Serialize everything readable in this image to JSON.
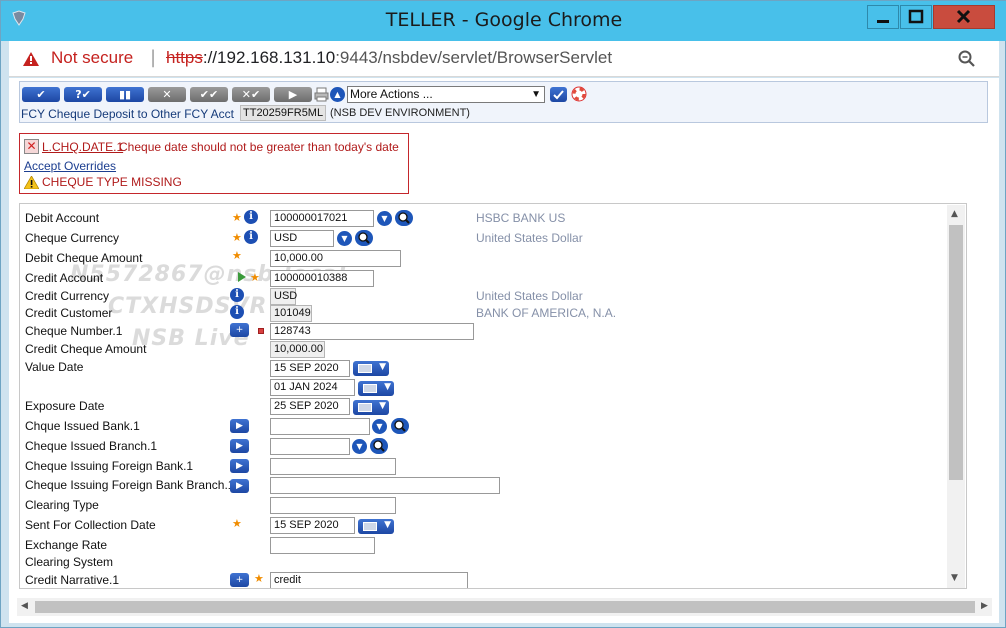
{
  "window": {
    "title": "TELLER - Google Chrome"
  },
  "address": {
    "security": "Not secure",
    "separator": "|",
    "scheme": "https",
    "host": "://192.168.131.10",
    "rest": ":9443/nsbdev/servlet/BrowserServlet"
  },
  "toolbar": {
    "more_actions": "More Actions ...",
    "transaction_label": "FCY Cheque Deposit to Other FCY Acct",
    "transaction_id": "TT20259FR5ML",
    "environment": "(NSB DEV ENVIRONMENT)"
  },
  "errors": {
    "field": "L.CHQ.DATE.1",
    "message": "Cheque date should not be greater than today's date",
    "accept_overrides": "Accept Overrides",
    "warning": "CHEQUE TYPE MISSING"
  },
  "watermark": {
    "line1": "N5572867@nsb.local",
    "line2": "CTXHSDSVR",
    "line3": "NSB Live"
  },
  "form": {
    "debit_account": {
      "label": "Debit Account",
      "value": "100000017021",
      "desc": "HSBC BANK US"
    },
    "cheque_currency": {
      "label": "Cheque Currency",
      "value": "USD",
      "desc": "United States Dollar"
    },
    "debit_cheque_amount": {
      "label": "Debit Cheque Amount",
      "value": "10,000.00"
    },
    "credit_account": {
      "label": "Credit Account",
      "value": "100000010388"
    },
    "credit_currency": {
      "label": "Credit Currency",
      "value": "USD",
      "desc": "United States Dollar"
    },
    "credit_customer": {
      "label": "Credit Customer",
      "value": "101049",
      "desc": "BANK OF AMERICA, N.A."
    },
    "cheque_number": {
      "label": "Cheque Number.1",
      "value": "128743"
    },
    "credit_cheque_amount": {
      "label": "Credit Cheque Amount",
      "value": "10,000.00"
    },
    "value_date": {
      "label": "Value Date",
      "value": "15 SEP 2020",
      "value2": "01 JAN 2024"
    },
    "exposure_date": {
      "label": "Exposure Date",
      "value": "25 SEP 2020"
    },
    "chque_issued_bank": {
      "label": "Chque Issued Bank.1",
      "value": ""
    },
    "cheque_issued_branch": {
      "label": "Cheque Issued Branch.1",
      "value": ""
    },
    "cheque_issuing_foreign_bank": {
      "label": "Cheque Issuing Foreign Bank.1",
      "value": ""
    },
    "cheque_issuing_foreign_branch": {
      "label": "Cheque Issuing Foreign Bank Branch.1",
      "value": ""
    },
    "clearing_type": {
      "label": "Clearing Type",
      "value": ""
    },
    "sent_for_collection_date": {
      "label": "Sent For Collection Date",
      "value": "15 SEP 2020"
    },
    "exchange_rate": {
      "label": "Exchange Rate",
      "value": ""
    },
    "clearing_system": {
      "label": "Clearing System"
    },
    "credit_narrative": {
      "label": "Credit Narrative.1",
      "value": "credit"
    }
  }
}
